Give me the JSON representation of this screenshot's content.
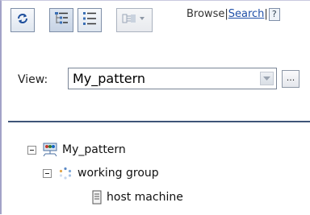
{
  "toolbar": {
    "refresh_icon": "refresh-icon",
    "tree_view_icon": "tree-view-icon",
    "list_view_icon": "list-view-icon",
    "layout_dropdown_icon": "layout-dropdown-icon"
  },
  "links": {
    "browse": "Browse",
    "separator": "|",
    "search": "Search",
    "help": "?"
  },
  "view": {
    "label": "View:",
    "selected": "My_pattern",
    "more_button": "..."
  },
  "tree": {
    "root": {
      "label": "My_pattern",
      "icon": "pattern-icon",
      "expanded": true
    },
    "group": {
      "label": "working group",
      "icon": "group-icon",
      "expanded": true
    },
    "leaf": {
      "label": "host machine",
      "icon": "host-icon"
    }
  },
  "colors": {
    "link": "#1f4fa8",
    "divider": "#3e5578",
    "frame_border": "#a3a3c8"
  }
}
